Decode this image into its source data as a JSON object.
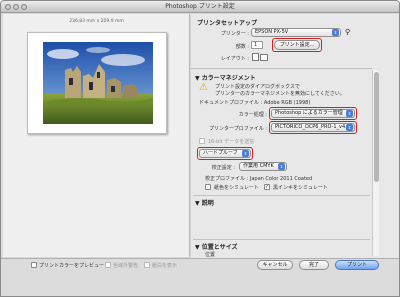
{
  "window": {
    "title": "Photoshop プリント設定"
  },
  "preview": {
    "paper_size": "236.83 mm x 209.9 mm"
  },
  "printer_setup": {
    "heading": "プリンタセットアップ",
    "printer_label": "プリンター :",
    "printer_value": "EPSON PX-5V",
    "copies_label": "部数 :",
    "copies_value": "1",
    "print_settings_button": "プリント設定...",
    "layout_label": "レイアウト :"
  },
  "color_management": {
    "heading": "カラーマネジメント",
    "note_line1": "プリント設定のダイアログボックスで",
    "note_line2": "プリンターのカラーマネジメントを無効にしてください。",
    "doc_profile": "ドキュメントプロファイル : Adobe RGB (1998)",
    "color_handling_label": "カラー処理 :",
    "color_handling_value": "Photoshop によるカラー管理",
    "printer_profile_label": "プリンタープロファイル :",
    "printer_profile_value": "PICTORICO_OCP6_PRO-1_v4.icc",
    "send_16bit": "16-bit データを送信",
    "hard_proof_value": "ハードプルーフ",
    "proof_setup_label": "校正設定 :",
    "proof_setup_value": "作業用 CMYK",
    "proof_profile": "校正プロファイル : Japan Color 2011 Coated",
    "simulate_paper": "紙色をシミュレート",
    "simulate_black": "黒インキをシミュレート"
  },
  "description": {
    "heading": "説明"
  },
  "position_size": {
    "heading": "位置とサイズ",
    "sub": "位置"
  },
  "bottom": {
    "preview_colors": "プリントカラーをプレビュー",
    "out_of_gamut": "色域外警告",
    "show_paper_white": "紙白を表示",
    "cancel": "キャンセル",
    "done": "完了",
    "print": "プリント"
  },
  "colors": {
    "highlight": "#d62020",
    "accent": "#4a7fd4"
  }
}
